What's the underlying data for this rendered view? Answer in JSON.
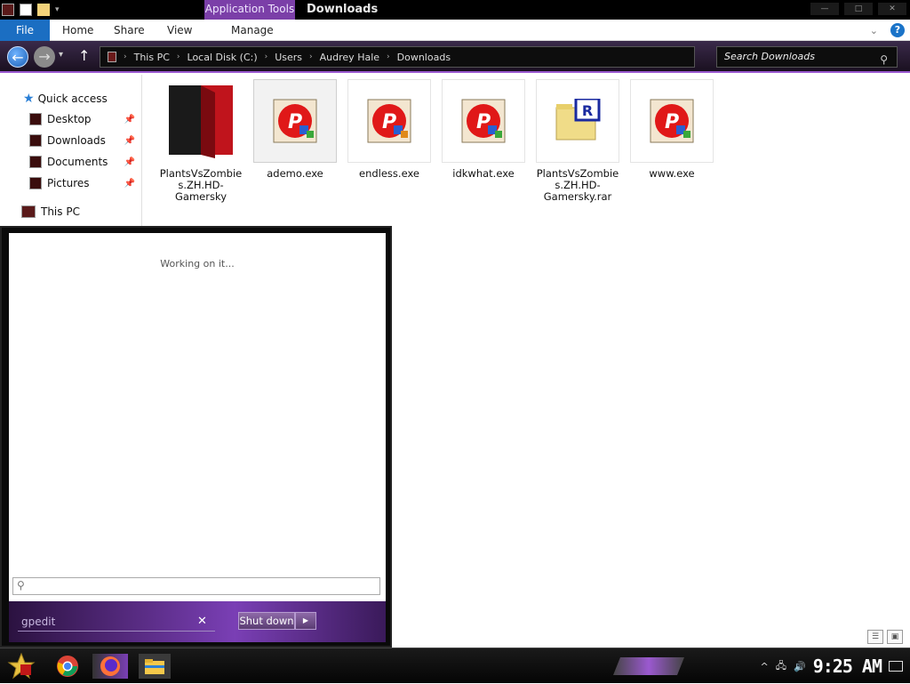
{
  "titlebar": {
    "context_tab": "Application Tools",
    "title": "Downloads"
  },
  "ribbon": {
    "file": "File",
    "tabs": [
      "Home",
      "Share",
      "View",
      "Manage"
    ]
  },
  "address": {
    "crumbs": [
      "This PC",
      "Local Disk (C:)",
      "Users",
      "Audrey Hale",
      "Downloads"
    ],
    "search_placeholder": "Search Downloads"
  },
  "nav": {
    "quick_access": "Quick access",
    "pinned": [
      "Desktop",
      "Downloads",
      "Documents",
      "Pictures"
    ],
    "this_pc": "This PC"
  },
  "files": [
    {
      "name": "PlantsVsZombies.ZH.HD-Gamersky",
      "icon": "folder-icon"
    },
    {
      "name": "ademo.exe",
      "icon": "exe-icon"
    },
    {
      "name": "endless.exe",
      "icon": "exe-icon"
    },
    {
      "name": "idkwhat.exe",
      "icon": "exe-icon"
    },
    {
      "name": "PlantsVsZombies.ZH.HD-Gamersky.rar",
      "icon": "rar-icon"
    },
    {
      "name": "www.exe",
      "icon": "exe-icon"
    }
  ],
  "start_menu": {
    "status": "Working on it...",
    "run_value": "gpedit",
    "shutdown_label": "Shut down"
  },
  "taskbar": {
    "clock": "9:25 AM"
  },
  "colors": {
    "accent": "#9b59d0",
    "file_tab": "#1b6ec2"
  }
}
